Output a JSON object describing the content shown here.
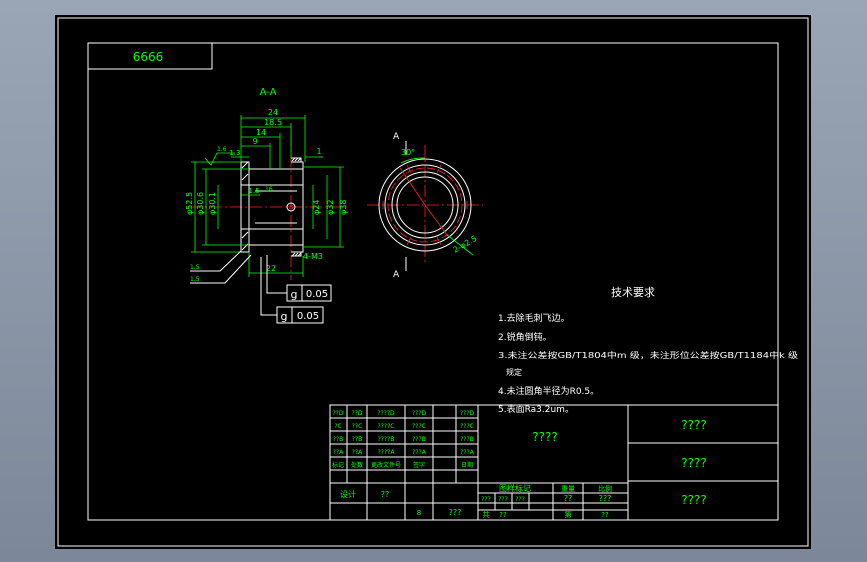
{
  "colors": {
    "background": "#000000",
    "outline": "#ffffff",
    "dimension": "#00ff00",
    "centerline": "#ff2020",
    "window_frame": "#9aa6b6"
  },
  "drawing_number": "6666",
  "section_label": "A-A",
  "section_mark": "A",
  "dimensions": {
    "d24": "24",
    "d18_5": "18.5",
    "d14": "14",
    "d9": "9",
    "d1_3": "1.3",
    "d1": "1",
    "d1_5": "1.5",
    "d22": "22",
    "d_phi52_5": "φ52.5",
    "d_phi30_6": "φ30.6",
    "d_phi30_1": "φ30.1",
    "d_phi24": "φ24",
    "d_phi32": "φ32",
    "d_phi38": "φ38",
    "thread": "4-M3",
    "angle": "30°",
    "holes": "2-φ2.5",
    "roughness": "1.6",
    "roughness2": "16"
  },
  "tolerance_frames": [
    {
      "symbol": "g",
      "value": "0.05"
    },
    {
      "symbol": "g",
      "value": "0.05"
    }
  ],
  "leader_notes": [
    "1.5",
    "1.5"
  ],
  "tech_req": {
    "title": "技术要求",
    "lines": [
      "1.去除毛刺飞边。",
      "2.锐角倒钝。",
      "3.未注公差按GB/T1804中m 级，未注形位公差按GB/T1184中k 级",
      "规定",
      "4.未注圆角半径为R0.5。",
      "5.表面Ra3.2um。"
    ]
  },
  "title_block": {
    "rev_rows": [
      [
        "??D",
        "??D",
        "????D",
        "???D",
        "???D"
      ],
      [
        "?C",
        "??C",
        "????C",
        "???C",
        "???C"
      ],
      [
        "??B",
        "??B",
        "????B",
        "???B",
        "???B"
      ],
      [
        "??A",
        "??A",
        "????A",
        "???A",
        "???A"
      ],
      [
        "标记",
        "处数",
        "更改文件号",
        "签字",
        "日期"
      ]
    ],
    "design_label": "设计",
    "design_value": "??",
    "review_value": "???",
    "center_title": "????",
    "stage_header": "图样标记",
    "weight_header": "重量",
    "scale_header": "比例",
    "stage_cells": [
      "???",
      "???",
      "???"
    ],
    "weight_value": "??",
    "scale_value": "???",
    "sheet_label": "共",
    "sheet_of": "第",
    "sheet_count": "??",
    "sheet_num": "??",
    "right_cells": [
      "????",
      "????",
      "????"
    ]
  }
}
